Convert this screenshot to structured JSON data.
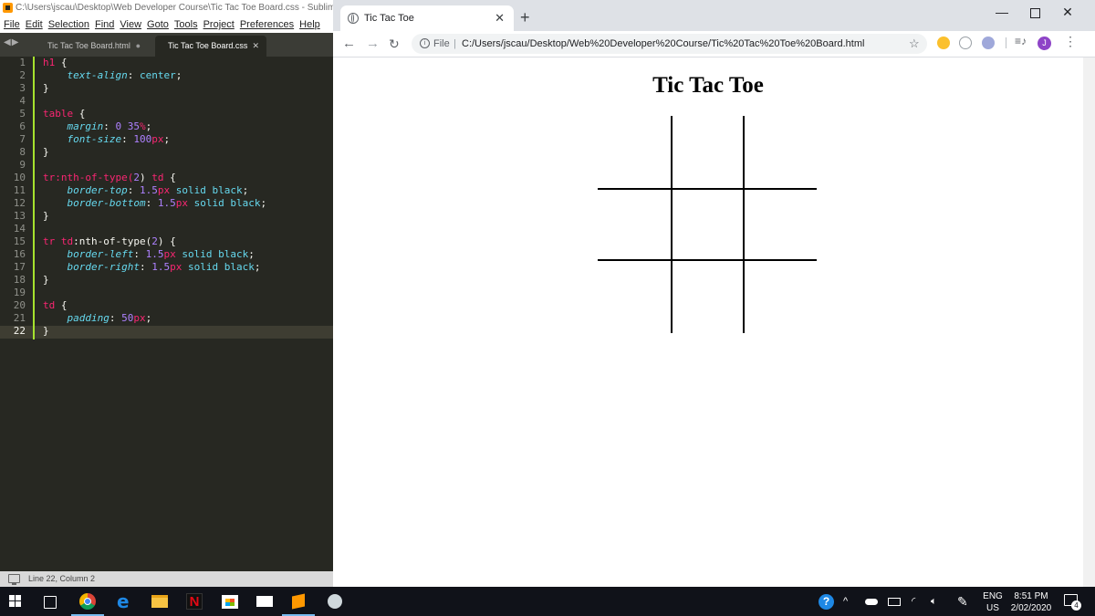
{
  "sublime": {
    "title": "C:\\Users\\jscau\\Desktop\\Web Developer Course\\Tic Tac Toe Board.css - Sublime Text",
    "menu": [
      "File",
      "Edit",
      "Selection",
      "Find",
      "View",
      "Goto",
      "Tools",
      "Project",
      "Preferences",
      "Help"
    ],
    "tabs": [
      {
        "label": "Tic Tac Toe Board.html",
        "state": "unsaved"
      },
      {
        "label": "Tic Tac Toe Board.css",
        "state": "active"
      }
    ],
    "line_numbers": [
      "1",
      "2",
      "3",
      "4",
      "5",
      "6",
      "7",
      "8",
      "9",
      "10",
      "11",
      "12",
      "13",
      "14",
      "15",
      "16",
      "17",
      "18",
      "19",
      "20",
      "21",
      "22"
    ],
    "code": {
      "l1_sel": "h1",
      "l1_brace": " {",
      "l2_prop": "text-align",
      "l2_colon": ": ",
      "l2_val": "center",
      "l2_semi": ";",
      "l3": "}",
      "l5_sel": "table",
      "l5_brace": " {",
      "l6_prop": "margin",
      "l6_colon": ": ",
      "l6_num": "0 35",
      "l6_unit": "%",
      "l6_semi": ";",
      "l7_prop": "font-size",
      "l7_colon": ": ",
      "l7_num": "100",
      "l7_unit": "px",
      "l7_semi": ";",
      "l8": "}",
      "l10_a": "tr:nth-of-type(",
      "l10_num": "2",
      "l10_b": ") ",
      "l10_td": "td",
      "l10_brace": " {",
      "l11_prop": "border-top",
      "l11_colon": ": ",
      "l11_num": "1.5",
      "l11_unit": "px",
      "l11_val": " solid black",
      "l11_semi": ";",
      "l12_prop": "border-bottom",
      "l12_colon": ": ",
      "l12_num": "1.5",
      "l12_unit": "px",
      "l12_val": " solid black",
      "l12_semi": ";",
      "l13": "}",
      "l15_sel": "tr td",
      "l15_a": ":nth-of-type(",
      "l15_num": "2",
      "l15_b": ") {",
      "l16_prop": "border-left",
      "l16_colon": ": ",
      "l16_num": "1.5",
      "l16_unit": "px",
      "l16_val": " solid black",
      "l16_semi": ";",
      "l17_prop": "border-right",
      "l17_colon": ": ",
      "l17_num": "1.5",
      "l17_unit": "px",
      "l17_val": " solid black",
      "l17_semi": ";",
      "l18": "}",
      "l20_sel": "td",
      "l20_brace": " {",
      "l21_prop": "padding",
      "l21_colon": ": ",
      "l21_num": "50",
      "l21_unit": "px",
      "l21_semi": ";",
      "l22": "}"
    },
    "status": "Line 22, Column 2"
  },
  "chrome": {
    "tab_title": "Tic Tac Toe",
    "tab_close": "✕",
    "new_tab": "+",
    "address_scheme": "File",
    "address_url": "C:/Users/jscau/Desktop/Web%20Developer%20Course/Tic%20Tac%20Toe%20Board.html",
    "profile_initial": "J",
    "page": {
      "heading": "Tic Tac Toe"
    }
  },
  "taskbar": {
    "language": "ENG",
    "region": "US",
    "time": "8:51 PM",
    "date": "2/02/2020",
    "notification_count": "4",
    "netflix_letter": "N",
    "edge_letter": "e",
    "help_glyph": "?"
  },
  "colors": {
    "editor_bg": "#272822",
    "keyword": "#f92672",
    "property": "#66d9ef",
    "number": "#ae81ff",
    "taskbar_bg": "#101219"
  }
}
